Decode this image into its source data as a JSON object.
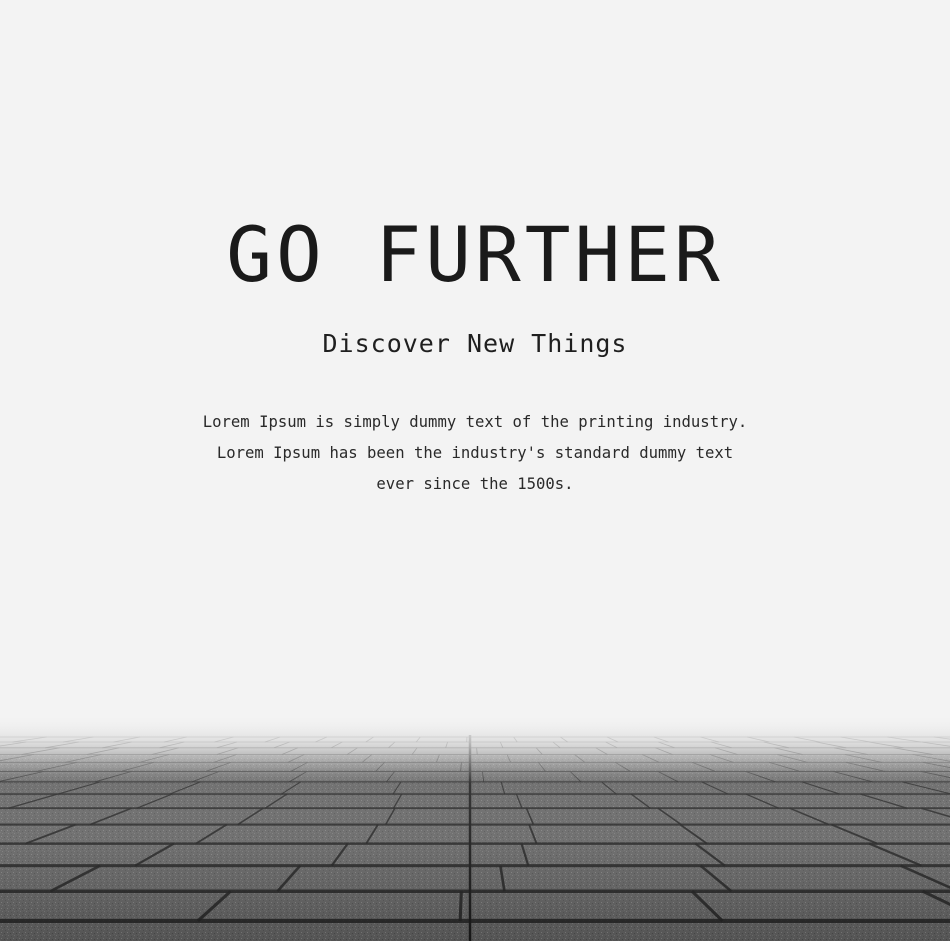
{
  "hero": {
    "title": "GO FURTHER",
    "subtitle": "Discover New Things",
    "description": "Lorem Ipsum is simply dummy text of the printing industry. Lorem Ipsum has been the industry's standard dummy text ever since the 1500s."
  },
  "colors": {
    "background": "#f3f3f3",
    "text": "#1a1a1a",
    "pavement_dark": "#1c1c1c",
    "pavement_light": "#8a8a8a"
  }
}
